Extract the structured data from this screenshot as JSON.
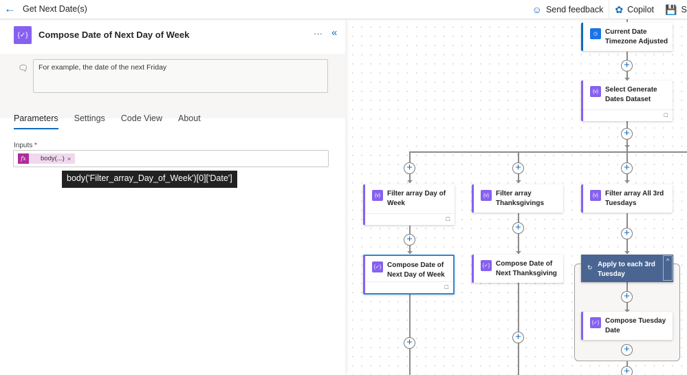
{
  "header": {
    "title": "Get Next Date(s)",
    "back_icon": "arrow-left-icon",
    "buttons": [
      {
        "label": "Send feedback",
        "icon": "feedback-icon"
      },
      {
        "label": "Copilot",
        "icon": "copilot-icon"
      },
      {
        "label": "Save",
        "icon": "save-icon"
      }
    ]
  },
  "panel": {
    "title": "Compose Date of Next Day of Week",
    "icon": "compose-icon",
    "more_label": "···",
    "collapse_label": "«",
    "description": "For example, the date of the next Friday",
    "tabs": [
      "Parameters",
      "Settings",
      "Code View",
      "About"
    ],
    "active_tab": "Parameters",
    "inputs_label": "Inputs",
    "required_mark": "*",
    "token_fx": "fx",
    "token_text": "body(...)",
    "token_remove": "×",
    "tooltip": "body('Filter_array_Day_of_Week')[0]['Date']"
  },
  "canvas": {
    "nodes": {
      "current_date": "Current Date Timezone Adjusted",
      "select_dates": "Select Generate Dates Dataset",
      "filter_dow": "Filter array Day of Week",
      "filter_thanks": "Filter array Thanksgivings",
      "filter_tue": "Filter array All 3rd Tuesdays",
      "compose_dow": "Compose Date of Next Day of Week",
      "compose_thanks": "Compose Date of Next Thanksgiving",
      "apply_each": "Apply to each 3rd Tuesday",
      "compose_tue": "Compose Tuesday Date"
    },
    "plus_symbol": "+",
    "note_symbol": "💬",
    "chevron_up": "^"
  }
}
